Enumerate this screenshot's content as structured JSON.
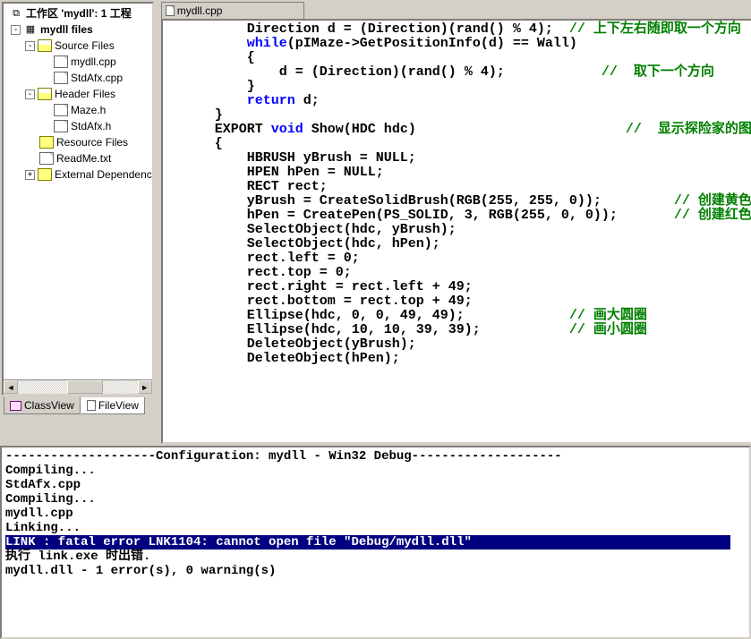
{
  "tree": {
    "workspace": "工作区 'mydll': 1 工程",
    "project": "mydll files",
    "sourceFolder": "Source Files",
    "source1": "mydll.cpp",
    "source2": "StdAfx.cpp",
    "headerFolder": "Header Files",
    "header1": "Maze.h",
    "header2": "StdAfx.h",
    "resourceFolder": "Resource Files",
    "readme": "ReadMe.txt",
    "external": "External Dependenc"
  },
  "tabs": {
    "classView": "ClassView",
    "fileView": "FileView"
  },
  "code": {
    "fileTab": "mydll.cpp",
    "lines": [
      {
        "indent": 10,
        "segs": [
          {
            "t": "Direction d = (Direction)(rand() % 4);  ",
            "c": "tx"
          },
          {
            "t": "// 上下左右随即取一个方向",
            "c": "cm"
          }
        ]
      },
      {
        "indent": 10,
        "segs": [
          {
            "t": "while",
            "c": "kw"
          },
          {
            "t": "(pIMaze->GetPositionInfo(d) == Wall)",
            "c": "tx"
          }
        ]
      },
      {
        "indent": 10,
        "segs": [
          {
            "t": "{",
            "c": "tx"
          }
        ]
      },
      {
        "indent": 14,
        "segs": [
          {
            "t": "d = (Direction)(rand() % 4);            ",
            "c": "tx"
          },
          {
            "t": "//  取下一个方向",
            "c": "cm"
          }
        ]
      },
      {
        "indent": 10,
        "segs": [
          {
            "t": "}",
            "c": "tx"
          }
        ]
      },
      {
        "indent": 10,
        "segs": [
          {
            "t": "return",
            "c": "kw"
          },
          {
            "t": " d;",
            "c": "tx"
          }
        ]
      },
      {
        "indent": 6,
        "segs": [
          {
            "t": "}",
            "c": "tx"
          }
        ]
      },
      {
        "indent": 6,
        "segs": [
          {
            "t": "EXPORT ",
            "c": "tx"
          },
          {
            "t": "void",
            "c": "kw"
          },
          {
            "t": " Show(HDC hdc)                          ",
            "c": "tx"
          },
          {
            "t": "//  显示探险家的图案",
            "c": "cm"
          }
        ]
      },
      {
        "indent": 6,
        "segs": [
          {
            "t": "{",
            "c": "tx"
          }
        ]
      },
      {
        "indent": 10,
        "segs": [
          {
            "t": "HBRUSH yBrush = NULL;",
            "c": "tx"
          }
        ]
      },
      {
        "indent": 10,
        "segs": [
          {
            "t": "HPEN hPen = NULL;",
            "c": "tx"
          }
        ]
      },
      {
        "indent": 10,
        "segs": [
          {
            "t": "RECT rect;",
            "c": "tx"
          }
        ]
      },
      {
        "indent": 0,
        "segs": [
          {
            "t": "",
            "c": "tx"
          }
        ]
      },
      {
        "indent": 10,
        "segs": [
          {
            "t": "yBrush = CreateSolidBrush(RGB(255, 255, 0));         ",
            "c": "tx"
          },
          {
            "t": "// 创建黄色画刷",
            "c": "cm"
          }
        ]
      },
      {
        "indent": 10,
        "segs": [
          {
            "t": "hPen = CreatePen(PS_SOLID, 3, RGB(255, 0, 0));       ",
            "c": "tx"
          },
          {
            "t": "// 创建红色画笔",
            "c": "cm"
          }
        ]
      },
      {
        "indent": 0,
        "segs": [
          {
            "t": "",
            "c": "tx"
          }
        ]
      },
      {
        "indent": 10,
        "segs": [
          {
            "t": "SelectObject(hdc, yBrush);",
            "c": "tx"
          }
        ]
      },
      {
        "indent": 10,
        "segs": [
          {
            "t": "SelectObject(hdc, hPen);",
            "c": "tx"
          }
        ]
      },
      {
        "indent": 0,
        "segs": [
          {
            "t": "",
            "c": "tx"
          }
        ]
      },
      {
        "indent": 10,
        "segs": [
          {
            "t": "rect.left = 0;",
            "c": "tx"
          }
        ]
      },
      {
        "indent": 10,
        "segs": [
          {
            "t": "rect.top = 0;",
            "c": "tx"
          }
        ]
      },
      {
        "indent": 10,
        "segs": [
          {
            "t": "rect.right = rect.left + 49;",
            "c": "tx"
          }
        ]
      },
      {
        "indent": 10,
        "segs": [
          {
            "t": "rect.bottom = rect.top + 49;",
            "c": "tx"
          }
        ]
      },
      {
        "indent": 0,
        "segs": [
          {
            "t": "",
            "c": "tx"
          }
        ]
      },
      {
        "indent": 10,
        "segs": [
          {
            "t": "Ellipse(hdc, 0, 0, 49, 49);             ",
            "c": "tx"
          },
          {
            "t": "// 画大圆圈",
            "c": "cm"
          }
        ]
      },
      {
        "indent": 10,
        "segs": [
          {
            "t": "Ellipse(hdc, 10, 10, 39, 39);           ",
            "c": "tx"
          },
          {
            "t": "// 画小圆圈",
            "c": "cm"
          }
        ]
      },
      {
        "indent": 0,
        "segs": [
          {
            "t": "",
            "c": "tx"
          }
        ]
      },
      {
        "indent": 10,
        "segs": [
          {
            "t": "DeleteObject(yBrush);",
            "c": "tx"
          }
        ]
      },
      {
        "indent": 10,
        "segs": [
          {
            "t": "DeleteObject(hPen);",
            "c": "tx"
          }
        ]
      }
    ]
  },
  "output": {
    "lines": [
      "--------------------Configuration: mydll - Win32 Debug--------------------",
      "Compiling...",
      "StdAfx.cpp",
      "Compiling...",
      "mydll.cpp",
      "Linking..."
    ],
    "errorLine": "LINK : fatal error LNK1104: cannot open file \"Debug/mydll.dll\"",
    "after1": "执行 link.exe 时出错.",
    "blank": "",
    "summary": "mydll.dll - 1 error(s), 0 warning(s)"
  }
}
